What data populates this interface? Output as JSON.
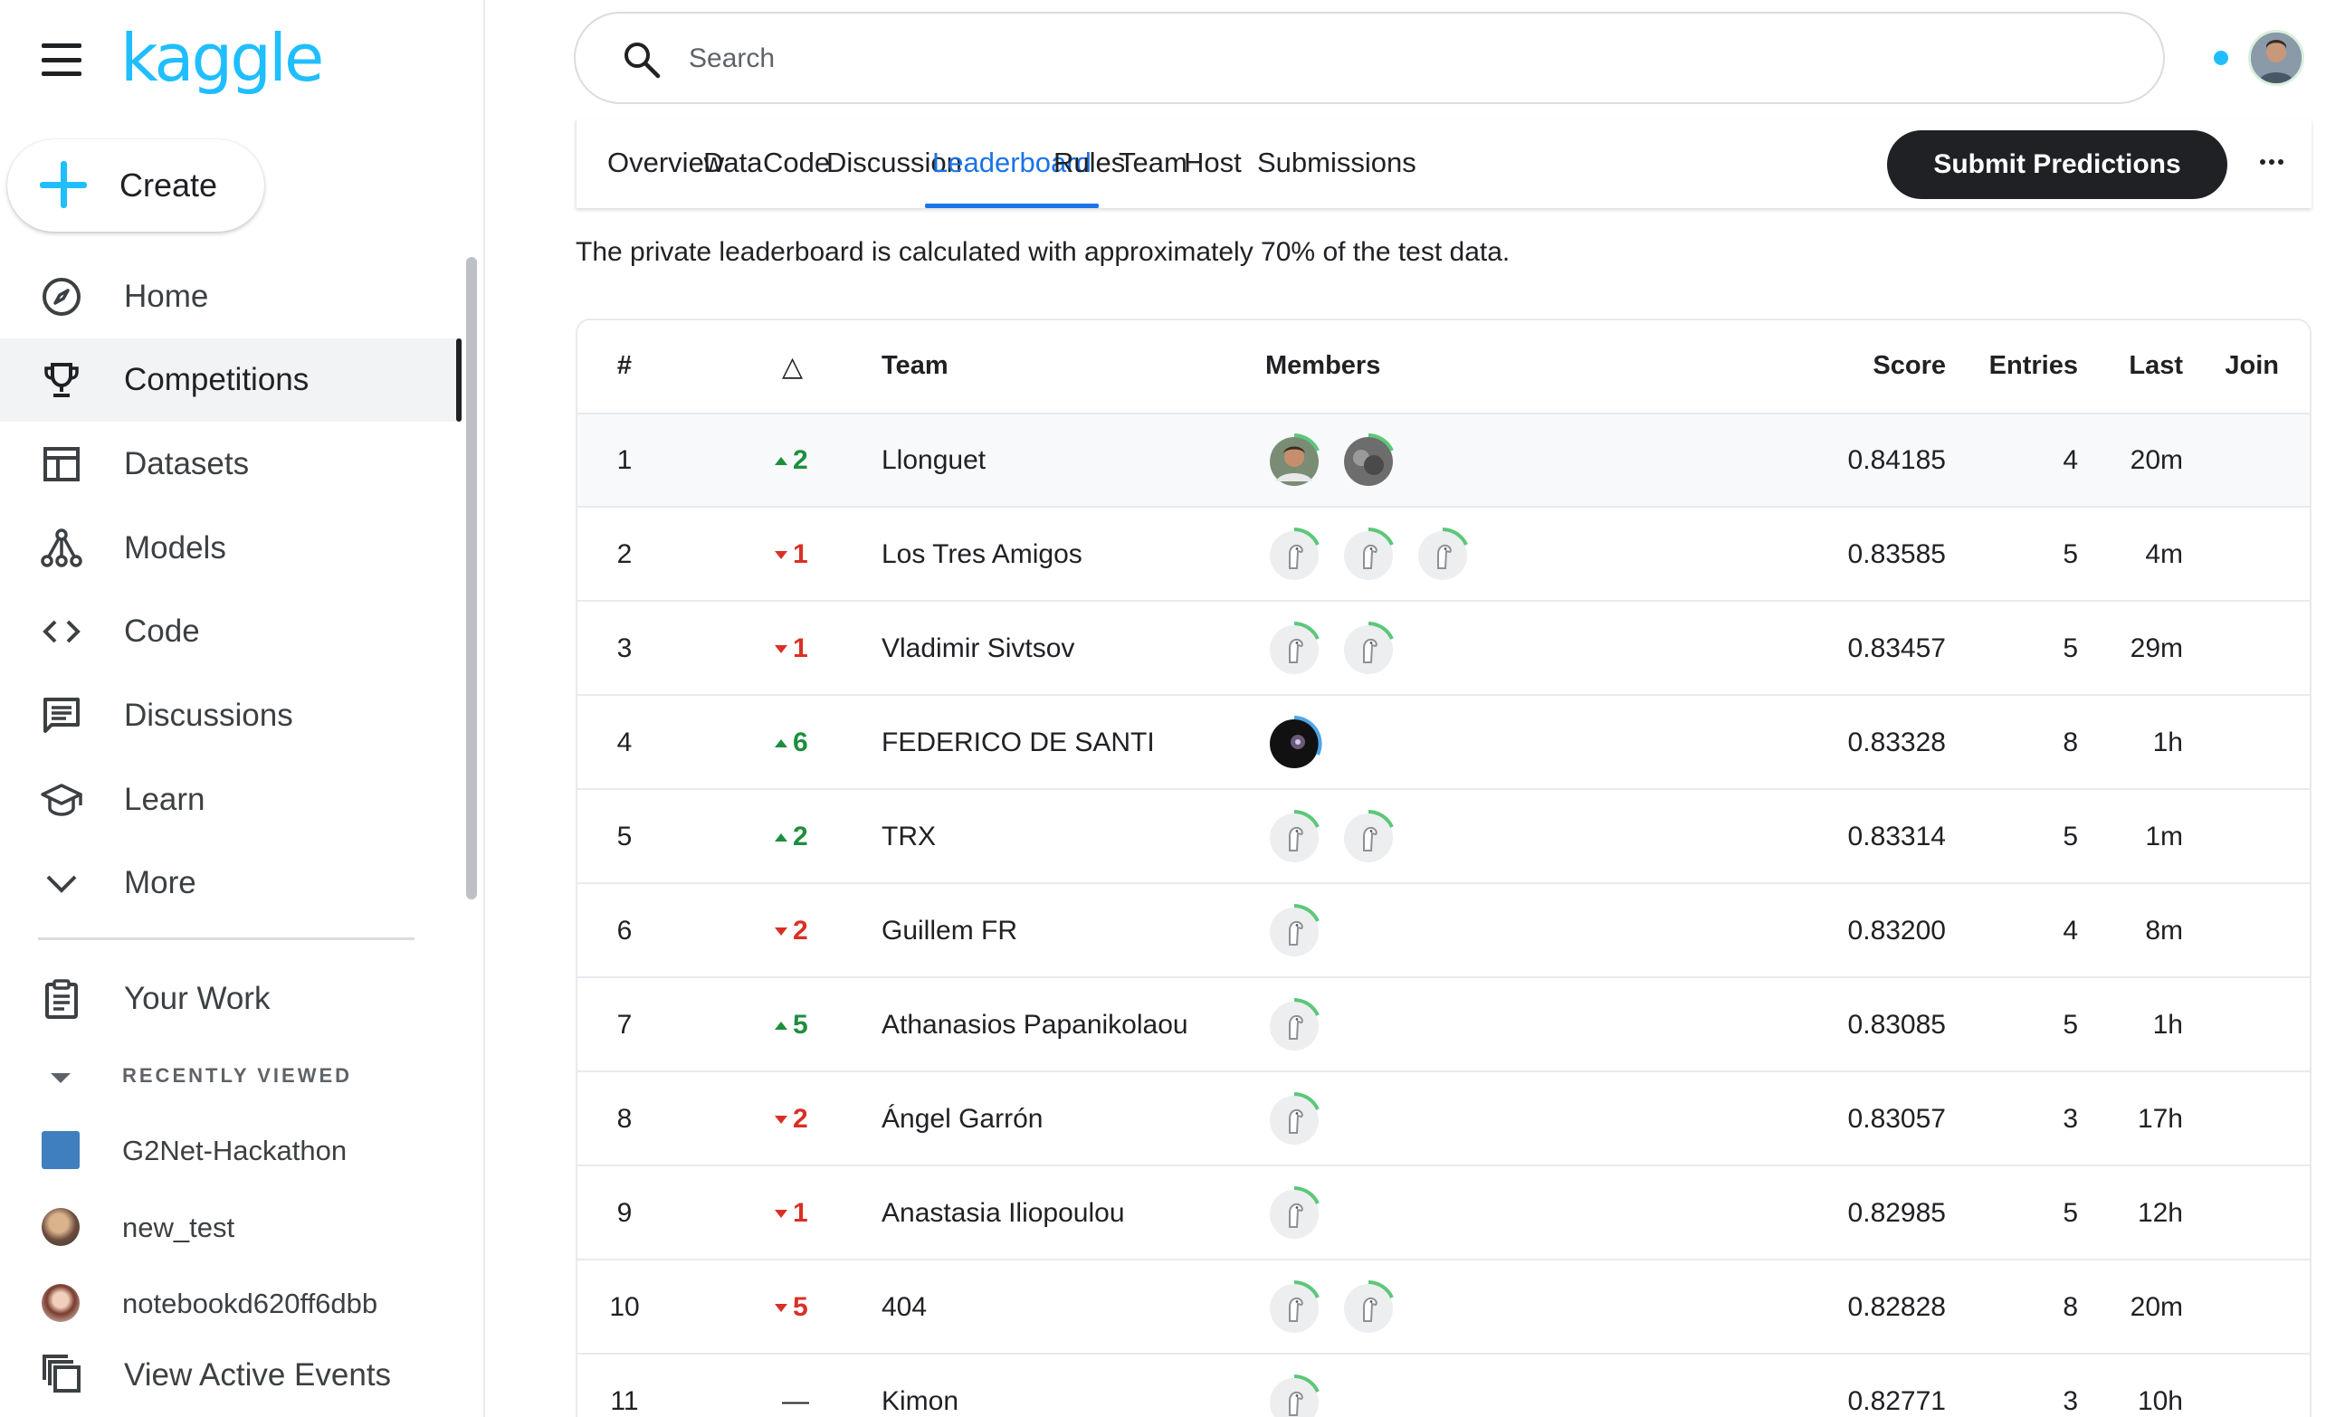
{
  "sidebar": {
    "logo": "kaggle",
    "create_label": "Create",
    "nav": [
      {
        "label": "Home",
        "icon": "compass-icon"
      },
      {
        "label": "Competitions",
        "icon": "trophy-icon"
      },
      {
        "label": "Datasets",
        "icon": "table-icon"
      },
      {
        "label": "Models",
        "icon": "models-icon"
      },
      {
        "label": "Code",
        "icon": "code-icon"
      },
      {
        "label": "Discussions",
        "icon": "discussion-icon"
      },
      {
        "label": "Learn",
        "icon": "graduation-cap-icon"
      },
      {
        "label": "More",
        "icon": "chevron-down-icon"
      }
    ],
    "your_work": "Your Work",
    "recently_viewed_title": "RECENTLY VIEWED",
    "recent": [
      {
        "label": "G2Net-Hackathon"
      },
      {
        "label": "new_test"
      },
      {
        "label": "notebookd620ff6dbb"
      }
    ],
    "view_active_events": "View Active Events"
  },
  "search": {
    "placeholder": "Search"
  },
  "tabs": {
    "items": [
      "Overview",
      "Data",
      "Code",
      "Discussion",
      "Leaderboard",
      "Rules",
      "Team",
      "Host",
      "Submissions"
    ],
    "active": "Leaderboard",
    "submit_label": "Submit Predictions"
  },
  "notice": "The private leaderboard is calculated with approximately 70% of the test data.",
  "leaderboard": {
    "headers": {
      "rank": "#",
      "delta": "△",
      "team": "Team",
      "members": "Members",
      "score": "Score",
      "entries": "Entries",
      "last": "Last",
      "join": "Join"
    },
    "rows": [
      {
        "rank": "1",
        "dir": "up",
        "delta": "2",
        "team": "Llonguet",
        "members": 2,
        "score": "0.84185",
        "entries": "4",
        "last": "20m"
      },
      {
        "rank": "2",
        "dir": "down",
        "delta": "1",
        "team": "Los Tres Amigos",
        "members": 3,
        "score": "0.83585",
        "entries": "5",
        "last": "4m"
      },
      {
        "rank": "3",
        "dir": "down",
        "delta": "1",
        "team": "Vladimir Sivtsov",
        "members": 2,
        "score": "0.83457",
        "entries": "5",
        "last": "29m"
      },
      {
        "rank": "4",
        "dir": "up",
        "delta": "6",
        "team": "FEDERICO DE SANTI",
        "members": 1,
        "score": "0.83328",
        "entries": "8",
        "last": "1h"
      },
      {
        "rank": "5",
        "dir": "up",
        "delta": "2",
        "team": "TRX",
        "members": 2,
        "score": "0.83314",
        "entries": "5",
        "last": "1m"
      },
      {
        "rank": "6",
        "dir": "down",
        "delta": "2",
        "team": "Guillem FR",
        "members": 1,
        "score": "0.83200",
        "entries": "4",
        "last": "8m"
      },
      {
        "rank": "7",
        "dir": "up",
        "delta": "5",
        "team": "Athanasios Papanikolaou",
        "members": 1,
        "score": "0.83085",
        "entries": "5",
        "last": "1h"
      },
      {
        "rank": "8",
        "dir": "down",
        "delta": "2",
        "team": "Ángel Garrón",
        "members": 1,
        "score": "0.83057",
        "entries": "3",
        "last": "17h"
      },
      {
        "rank": "9",
        "dir": "down",
        "delta": "1",
        "team": "Anastasia Iliopoulou",
        "members": 1,
        "score": "0.82985",
        "entries": "5",
        "last": "12h"
      },
      {
        "rank": "10",
        "dir": "down",
        "delta": "5",
        "team": "404",
        "members": 2,
        "score": "0.82828",
        "entries": "8",
        "last": "20m"
      },
      {
        "rank": "11",
        "dir": "none",
        "delta": "—",
        "team": "Kimon",
        "members": 1,
        "score": "0.82771",
        "entries": "3",
        "last": "10h"
      }
    ]
  },
  "colors": {
    "accent": "#20beff",
    "tab_active": "#1a73e8",
    "up": "#1e8e3e",
    "down": "#d93025"
  }
}
